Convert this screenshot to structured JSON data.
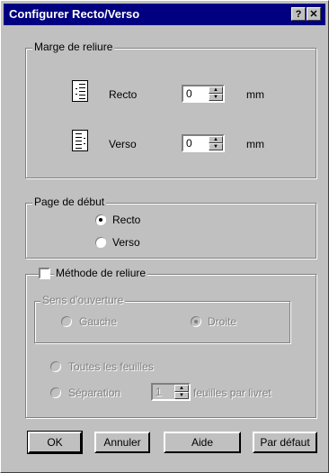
{
  "dialog": {
    "title": "Configurer Recto/Verso",
    "help_glyph": "?",
    "close_glyph": "✕"
  },
  "binding_margin": {
    "group_label": "Marge de reliure",
    "recto": {
      "label": "Recto",
      "value": "0",
      "unit": "mm",
      "icon": "recto-page-icon"
    },
    "verso": {
      "label": "Verso",
      "value": "0",
      "unit": "mm",
      "icon": "verso-page-icon"
    }
  },
  "start_page": {
    "group_label": "Page de début",
    "options": [
      {
        "label": "Recto",
        "selected": true
      },
      {
        "label": "Verso",
        "selected": false
      }
    ]
  },
  "binding_method": {
    "checkbox_label": "Méthode de reliure",
    "checked": false,
    "opening_direction": {
      "group_label": "Sens d'ouverture",
      "options": [
        {
          "label": "Gauche",
          "selected": false
        },
        {
          "label": "Droite",
          "selected": true
        }
      ]
    },
    "all_sheets_label": "Toutes les feuilles",
    "separation_label": "Séparation",
    "separation_value": "1",
    "sheets_per_booklet_label": "feuilles par livret"
  },
  "buttons": {
    "ok": "OK",
    "cancel": "Annuler",
    "help": "Aide",
    "default": "Par défaut"
  }
}
